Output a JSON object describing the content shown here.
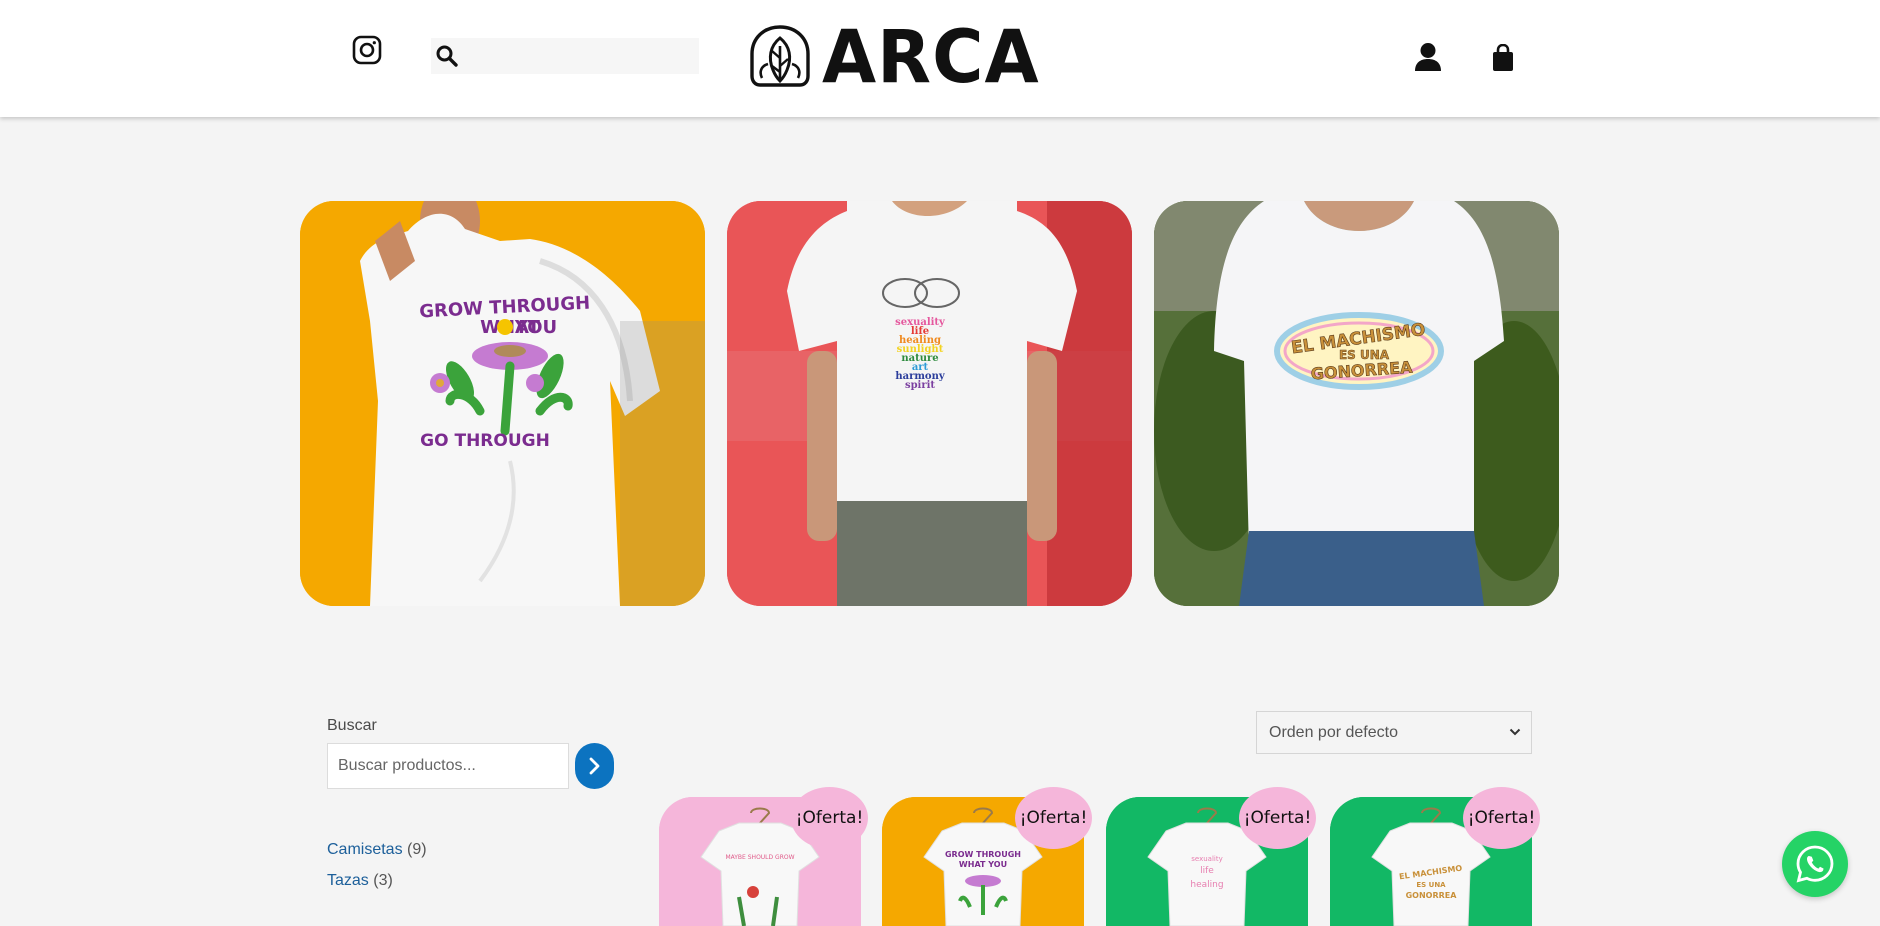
{
  "header": {
    "logo_text": "ARCA",
    "search_placeholder": ""
  },
  "icons": {
    "instagram": "instagram-icon",
    "search": "search-icon",
    "account": "user-icon",
    "cart": "shopping-bag-icon",
    "whatsapp": "whatsapp-icon"
  },
  "banners": [
    {
      "shirt_text": "GROW THROUGH WHAT YOU GO THROUGH",
      "background": "#f5a800"
    },
    {
      "shirt_text": "sexuality life healing sunlight nature art harmony spirit",
      "background": "#e94b4f"
    },
    {
      "shirt_text": "EL MACHISMO ES UNA GONORREA",
      "background": "#5b6e3a"
    }
  ],
  "sidebar": {
    "search_label": "Buscar",
    "search_placeholder": "Buscar productos...",
    "categories": [
      {
        "name": "Camisetas",
        "count": "(9)"
      },
      {
        "name": "Tazas",
        "count": "(3)"
      }
    ]
  },
  "sort": {
    "selected": "Orden por defecto"
  },
  "products": [
    {
      "badge": "¡Oferta!",
      "background": "#f5b6da"
    },
    {
      "badge": "¡Oferta!",
      "background": "#f5a800"
    },
    {
      "badge": "¡Oferta!",
      "background": "#12b865"
    },
    {
      "badge": "¡Oferta!",
      "background": "#12b865"
    }
  ],
  "colors": {
    "accent": "#0c73c0",
    "badge": "#f5b6da",
    "whatsapp": "#25d366",
    "link": "#1c5f9a"
  }
}
